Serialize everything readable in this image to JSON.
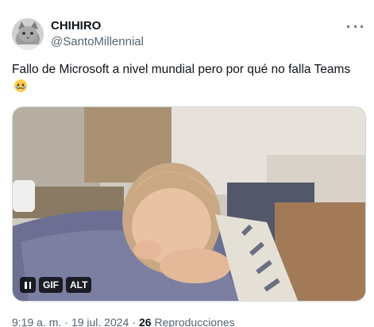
{
  "author": {
    "display_name": "CHIHIRO",
    "handle": "@SantoMillennial"
  },
  "tweet": {
    "text": "Fallo de Microsoft a nivel mundial pero por qué no falla Teams",
    "emoji": "face-holding-back-tears-icon"
  },
  "media": {
    "type": "gif",
    "gif_badge": "GIF",
    "alt_badge": "ALT"
  },
  "meta": {
    "time": "9:19 a. m.",
    "date": "19 jul. 2024",
    "view_count": "26",
    "views_label": "Reproducciones"
  },
  "colors": {
    "primary_text": "#0f1419",
    "secondary_text": "#536471",
    "border": "#cfd9de"
  }
}
